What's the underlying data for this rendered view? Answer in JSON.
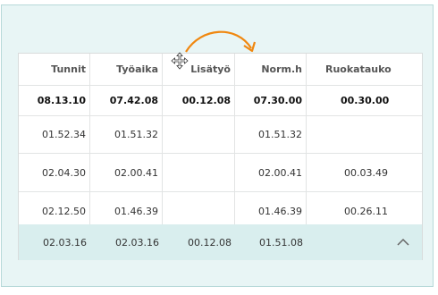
{
  "columns": [
    {
      "label": "Tunnit"
    },
    {
      "label": "Työaika"
    },
    {
      "label": "Lisätyö"
    },
    {
      "label": "Norm.h"
    },
    {
      "label": "Ruokatauko"
    }
  ],
  "summary": [
    "08.13.10",
    "07.42.08",
    "00.12.08",
    "07.30.00",
    "00.30.00"
  ],
  "rows": [
    [
      "01.52.34",
      "01.51.32",
      "",
      "01.51.32",
      ""
    ],
    [
      "02.04.30",
      "02.00.41",
      "",
      "02.00.41",
      "00.03.49"
    ],
    [
      "02.12.50",
      "01.46.39",
      "",
      "01.46.39",
      "00.26.11"
    ]
  ],
  "group_row": [
    "02.03.16",
    "02.03.16",
    "00.12.08",
    "01.51.08",
    ""
  ],
  "icons": {
    "collapse": "chevron-up-icon",
    "drag_cursor": "move-cursor-icon",
    "drag_indicator": "curved-arrow-icon"
  },
  "colors": {
    "panel_bg": "#e8f5f5",
    "group_row_bg": "#d9eeee",
    "drag_arrow": "#f0870f"
  }
}
